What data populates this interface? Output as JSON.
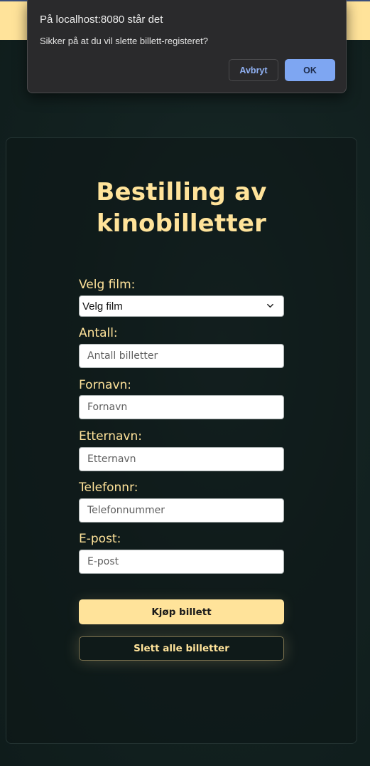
{
  "dialog": {
    "title": "På localhost:8080 står det",
    "message": "Sikker på at du vil slette billett-registeret?",
    "cancel_label": "Avbryt",
    "ok_label": "OK"
  },
  "form": {
    "heading_line1": "Bestilling av",
    "heading_line2": "kinobilletter",
    "film_label": "Velg film:",
    "film_selected": "Velg film",
    "count_label": "Antall:",
    "count_placeholder": "Antall billetter",
    "firstname_label": "Fornavn:",
    "firstname_placeholder": "Fornavn",
    "lastname_label": "Etternavn:",
    "lastname_placeholder": "Etternavn",
    "phone_label": "Telefonnr:",
    "phone_placeholder": "Telefonnummer",
    "email_label": "E-post:",
    "email_placeholder": "E-post",
    "buy_label": "Kjøp billett",
    "delete_label": "Slett alle billetter"
  },
  "colors": {
    "accent": "#ffe39a",
    "background": "#12201f",
    "dialog_bg": "#2a2a2c",
    "ok_button": "#7ea6f2"
  },
  "icons": {
    "select_arrow": "chevron-down-icon"
  }
}
